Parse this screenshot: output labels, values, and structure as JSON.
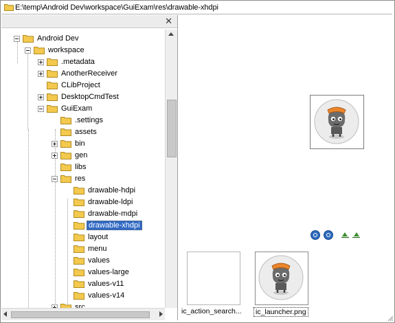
{
  "address_bar": {
    "path": "E:\\temp\\Android Dev\\workspace\\GuiExam\\res\\drawable-xhdpi"
  },
  "tree_pane": {
    "close_label": "✕"
  },
  "tree": {
    "items": [
      {
        "label": "Android Dev"
      },
      {
        "label": "workspace"
      },
      {
        "label": ".metadata"
      },
      {
        "label": "AnotherReceiver"
      },
      {
        "label": "CLibProject"
      },
      {
        "label": "DesktopCmdTest"
      },
      {
        "label": "GuiExam"
      },
      {
        "label": ".settings"
      },
      {
        "label": "assets"
      },
      {
        "label": "bin"
      },
      {
        "label": "gen"
      },
      {
        "label": "libs"
      },
      {
        "label": "res"
      },
      {
        "label": "drawable-hdpi"
      },
      {
        "label": "drawable-ldpi"
      },
      {
        "label": "drawable-mdpi"
      },
      {
        "label": "drawable-xhdpi"
      },
      {
        "label": "layout"
      },
      {
        "label": "menu"
      },
      {
        "label": "values"
      },
      {
        "label": "values-large"
      },
      {
        "label": "values-v11"
      },
      {
        "label": "values-v14"
      },
      {
        "label": "src"
      }
    ],
    "selected": "drawable-xhdpi"
  },
  "files": [
    {
      "caption": "ic_action_search..."
    },
    {
      "caption": "ic_launcher.png"
    }
  ],
  "colors": {
    "selection": "#316ac5",
    "folder": "#f3c94e"
  }
}
